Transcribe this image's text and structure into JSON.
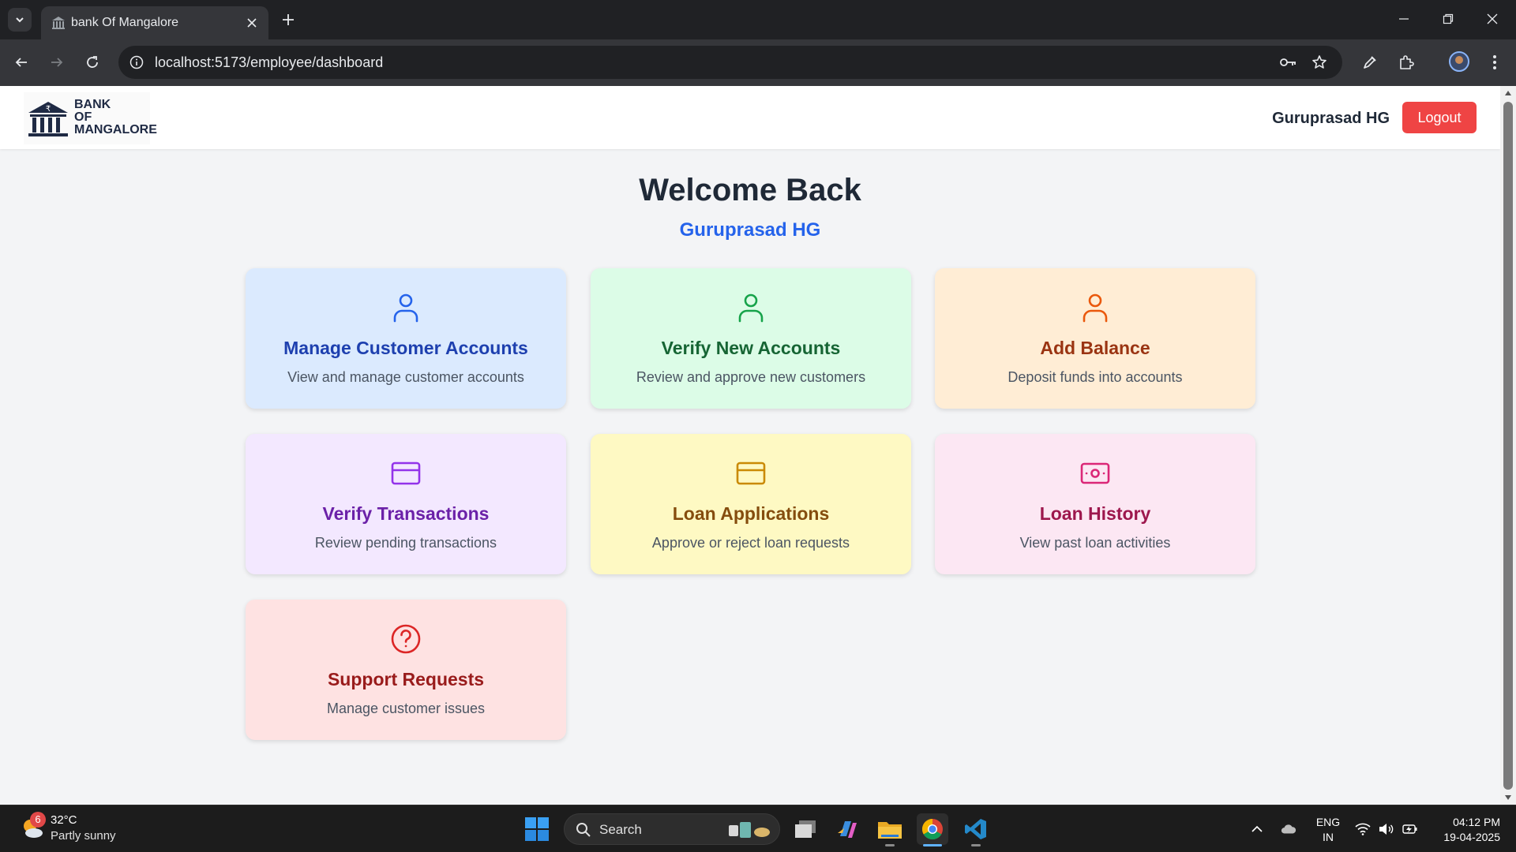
{
  "browser": {
    "tab_title": "bank Of Mangalore",
    "url": "localhost:5173/employee/dashboard"
  },
  "header": {
    "logo_lines": [
      "BANK",
      "OF",
      "MANGALORE"
    ],
    "user_name": "Guruprasad HG",
    "logout_label": "Logout"
  },
  "welcome": {
    "title": "Welcome Back",
    "name": "Guruprasad HG"
  },
  "cards": [
    {
      "title": "Manage Customer Accounts",
      "desc": "View and manage customer accounts",
      "icon": "user-icon",
      "bg": "#dbeafe",
      "color": "#1e40af",
      "icon_color": "#2563eb"
    },
    {
      "title": "Verify New Accounts",
      "desc": "Review and approve new customers",
      "icon": "user-icon",
      "bg": "#dcfce7",
      "color": "#166534",
      "icon_color": "#16a34a"
    },
    {
      "title": "Add Balance",
      "desc": "Deposit funds into accounts",
      "icon": "user-icon",
      "bg": "#ffedd5",
      "color": "#9a3412",
      "icon_color": "#ea580c"
    },
    {
      "title": "Verify Transactions",
      "desc": "Review pending transactions",
      "icon": "credit-card-icon",
      "bg": "#f3e8ff",
      "color": "#6b21a8",
      "icon_color": "#9333ea"
    },
    {
      "title": "Loan Applications",
      "desc": "Approve or reject loan requests",
      "icon": "credit-card-icon",
      "bg": "#fef9c3",
      "color": "#854d0e",
      "icon_color": "#ca8a04"
    },
    {
      "title": "Loan History",
      "desc": "View past loan activities",
      "icon": "banknote-icon",
      "bg": "#fce7f3",
      "color": "#9d174d",
      "icon_color": "#db2777"
    },
    {
      "title": "Support Requests",
      "desc": "Manage customer issues",
      "icon": "help-circle-icon",
      "bg": "#fee2e2",
      "color": "#991b1b",
      "icon_color": "#dc2626"
    }
  ],
  "taskbar": {
    "weather_badge": "6",
    "weather_temp": "32°C",
    "weather_desc": "Partly sunny",
    "search_label": "Search",
    "lang_line1": "ENG",
    "lang_line2": "IN",
    "time": "04:12 PM",
    "date": "19-04-2025"
  }
}
